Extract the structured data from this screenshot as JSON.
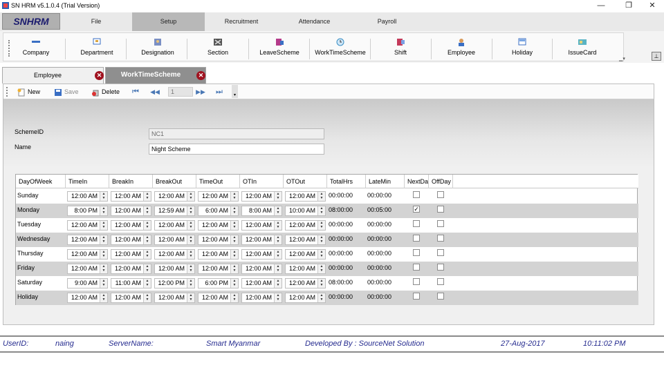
{
  "window": {
    "title": "SN HRM v5.1.0.4 (Trial Version)",
    "controls": {
      "minimize": "—",
      "restore": "❐",
      "close": "✕"
    }
  },
  "menubar": {
    "logo": "SNHRM",
    "items": [
      {
        "label": "File"
      },
      {
        "label": "Setup",
        "active": true
      },
      {
        "label": "Recruitment"
      },
      {
        "label": "Attendance"
      },
      {
        "label": "Payroll"
      }
    ]
  },
  "ribbon": {
    "items": [
      {
        "label": "Company",
        "icon": "company-icon"
      },
      {
        "label": "Department",
        "icon": "department-icon"
      },
      {
        "label": "Designation",
        "icon": "designation-icon"
      },
      {
        "label": "Section",
        "icon": "section-icon"
      },
      {
        "label": "LeaveScheme",
        "icon": "leave-scheme-icon"
      },
      {
        "label": "WorkTimeScheme",
        "icon": "work-time-scheme-icon"
      },
      {
        "label": "Shift",
        "icon": "shift-icon"
      },
      {
        "label": "Employee",
        "icon": "employee-icon"
      },
      {
        "label": "Holiday",
        "icon": "holiday-icon"
      },
      {
        "label": "IssueCard",
        "icon": "issue-card-icon"
      }
    ],
    "pin": "⊥"
  },
  "tabs": [
    {
      "label": "Employee",
      "active": false,
      "close": "✕"
    },
    {
      "label": "WorkTimeScheme",
      "active": true,
      "close": "✕"
    }
  ],
  "toolbar": {
    "new_label": "New",
    "save_label": "Save",
    "delete_label": "Delete",
    "position": "1",
    "nav": {
      "first": "⏮",
      "prev": "◀◀",
      "next": "▶▶",
      "last": "⏭"
    }
  },
  "form": {
    "scheme_id_label": "SchemeID",
    "scheme_id_value": "NC1",
    "name_label": "Name",
    "name_value": "Night Scheme"
  },
  "grid": {
    "columns": [
      "DayOfWeek",
      "TimeIn",
      "BreakIn",
      "BreakOut",
      "TimeOut",
      "OTIn",
      "OTOut",
      "TotalHrs",
      "LateMin",
      "NextDa",
      "OffDay"
    ],
    "rows": [
      {
        "day": "Sunday",
        "time_in": "12:00 AM",
        "break_in": "12:00 AM",
        "break_out": "12:00 AM",
        "time_out": "12:00 AM",
        "ot_in": "12:00 AM",
        "ot_out": "12:00 AM",
        "total_hrs": "00:00:00",
        "late_min": "00:00:00",
        "next_day": false,
        "off_day": false
      },
      {
        "day": "Monday",
        "time_in": "8:00 PM",
        "break_in": "12:00 AM",
        "break_out": "12:59 AM",
        "time_out": "6:00 AM",
        "ot_in": "8:00 AM",
        "ot_out": "10:00 AM",
        "total_hrs": "08:00:00",
        "late_min": "00:05:00",
        "next_day": true,
        "off_day": false
      },
      {
        "day": "Tuesday",
        "time_in": "12:00 AM",
        "break_in": "12:00 AM",
        "break_out": "12:00 AM",
        "time_out": "12:00 AM",
        "ot_in": "12:00 AM",
        "ot_out": "12:00 AM",
        "total_hrs": "00:00:00",
        "late_min": "00:00:00",
        "next_day": false,
        "off_day": false
      },
      {
        "day": "Wednesday",
        "time_in": "12:00 AM",
        "break_in": "12:00 AM",
        "break_out": "12:00 AM",
        "time_out": "12:00 AM",
        "ot_in": "12:00 AM",
        "ot_out": "12:00 AM",
        "total_hrs": "00:00:00",
        "late_min": "00:00:00",
        "next_day": false,
        "off_day": false
      },
      {
        "day": "Thursday",
        "time_in": "12:00 AM",
        "break_in": "12:00 AM",
        "break_out": "12:00 AM",
        "time_out": "12:00 AM",
        "ot_in": "12:00 AM",
        "ot_out": "12:00 AM",
        "total_hrs": "00:00:00",
        "late_min": "00:00:00",
        "next_day": false,
        "off_day": false
      },
      {
        "day": "Friday",
        "time_in": "12:00 AM",
        "break_in": "12:00 AM",
        "break_out": "12:00 AM",
        "time_out": "12:00 AM",
        "ot_in": "12:00 AM",
        "ot_out": "12:00 AM",
        "total_hrs": "00:00:00",
        "late_min": "00:00:00",
        "next_day": false,
        "off_day": false
      },
      {
        "day": "Saturday",
        "time_in": "9:00 AM",
        "break_in": "11:00 AM",
        "break_out": "12:00 PM",
        "time_out": "6:00 PM",
        "ot_in": "12:00 AM",
        "ot_out": "12:00 AM",
        "total_hrs": "08:00:00",
        "late_min": "00:00:00",
        "next_day": false,
        "off_day": false
      },
      {
        "day": "Holiday",
        "time_in": "12:00 AM",
        "break_in": "12:00 AM",
        "break_out": "12:00 AM",
        "time_out": "12:00 AM",
        "ot_in": "12:00 AM",
        "ot_out": "12:00 AM",
        "total_hrs": "00:00:00",
        "late_min": "00:00:00",
        "next_day": false,
        "off_day": false
      }
    ]
  },
  "status": {
    "user_label": "UserID:",
    "user_value": "naing",
    "server_label": "ServerName:",
    "server_value": "Smart Myanmar",
    "developer": "Developed By : SourceNet Solution",
    "date": "27-Aug-2017",
    "time": "10:11:02 PM"
  },
  "colors": {
    "tab_close": "#a0121f",
    "status_text": "#252b8f",
    "nav_arrows": "#4a78b5",
    "logo_text": "#1b1b6e"
  }
}
